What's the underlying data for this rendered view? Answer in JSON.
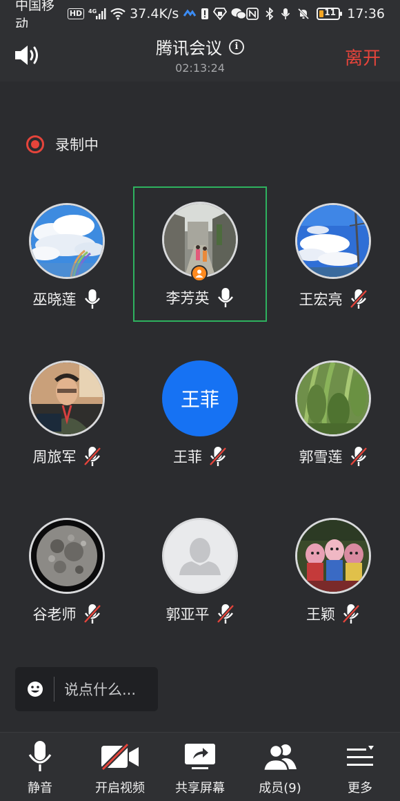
{
  "status_bar": {
    "carrier": "中国移动",
    "hd_badge": "HD",
    "network": "4G",
    "speed": "37.4K/s",
    "battery": "11",
    "time": "17:36"
  },
  "header": {
    "title": "腾讯会议",
    "duration": "02:13:24",
    "leave_label": "离开",
    "info_icon": "i"
  },
  "recording": {
    "label": "录制中"
  },
  "participants": [
    {
      "name": "巫晓莲",
      "mic": "on",
      "avatar": "sky-photo"
    },
    {
      "name": "李芳英",
      "mic": "on",
      "avatar": "street-photo",
      "host": true,
      "active": true
    },
    {
      "name": "王宏亮",
      "mic": "muted",
      "avatar": "blue-sky-photo"
    },
    {
      "name": "周旅军",
      "mic": "muted",
      "avatar": "portrait-photo"
    },
    {
      "name": "王菲",
      "mic": "muted",
      "avatar": "text",
      "avatar_text": "王菲"
    },
    {
      "name": "郭雪莲",
      "mic": "muted",
      "avatar": "green-plant-photo"
    },
    {
      "name": "谷老师",
      "mic": "muted",
      "avatar": "moon-photo"
    },
    {
      "name": "郭亚平",
      "mic": "muted",
      "avatar": "default-user"
    },
    {
      "name": "王颖",
      "mic": "muted",
      "avatar": "toys-photo"
    }
  ],
  "chat": {
    "placeholder": "说点什么..."
  },
  "toolbar": {
    "mute_label": "静音",
    "video_label": "开启视频",
    "share_label": "共享屏幕",
    "members_label": "成员(9)",
    "more_label": "更多"
  },
  "colors": {
    "background": "#2b2c2f",
    "leave": "#e5443b",
    "active_border": "#2eb35f",
    "avatar_blue": "#1672f3",
    "muted_slash": "#e5443b"
  }
}
